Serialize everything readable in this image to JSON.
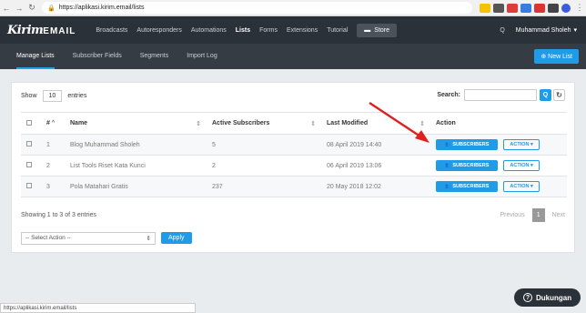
{
  "browser": {
    "url": "https://aplikasi.kirim.email/lists",
    "status_url": "https://aplikasi.kirim.email/lists"
  },
  "app": {
    "logo_main": "Kirim",
    "logo_suffix": "EMAIL",
    "menu": [
      "Broadcasts",
      "Autoresponders",
      "Automations",
      "Lists",
      "Forms",
      "Extensions",
      "Tutorial"
    ],
    "active_menu": "Lists",
    "store_label": "Store",
    "user_name": "Muhammad Sholeh"
  },
  "subnav": {
    "tabs": [
      "Manage Lists",
      "Subscriber Fields",
      "Segments",
      "Import Log"
    ],
    "new_list_label": "New List"
  },
  "table_controls": {
    "show_label": "Show",
    "entries_value": "10",
    "entries_label": "entries",
    "search_label": "Search:",
    "search_value": ""
  },
  "table": {
    "columns": [
      "#",
      "Name",
      "Active Subscribers",
      "Last Modified",
      "Action"
    ],
    "rows": [
      {
        "num": "1",
        "name": "Blog Muhammad Sholeh",
        "active": "5",
        "modified": "08 April 2019 14:40"
      },
      {
        "num": "2",
        "name": "List Tools Riset Kata Kunci",
        "active": "2",
        "modified": "06 April 2019 13:06"
      },
      {
        "num": "3",
        "name": "Pola Matahari Gratis",
        "active": "237",
        "modified": "20 May 2018 12:02"
      }
    ],
    "subscribers_label": "SUBSCRIBERS",
    "action_label": "ACTION"
  },
  "footer": {
    "info": "Showing 1 to 3 of 3 entries",
    "previous": "Previous",
    "current_page": "1",
    "next": "Next",
    "bulk_select": "-- Select Action --",
    "apply_label": "Apply"
  },
  "support_label": "Dukungan",
  "colors": {
    "accent": "#1f9be8",
    "nav_dark": "#2b3138",
    "arrow": "#e02020"
  }
}
